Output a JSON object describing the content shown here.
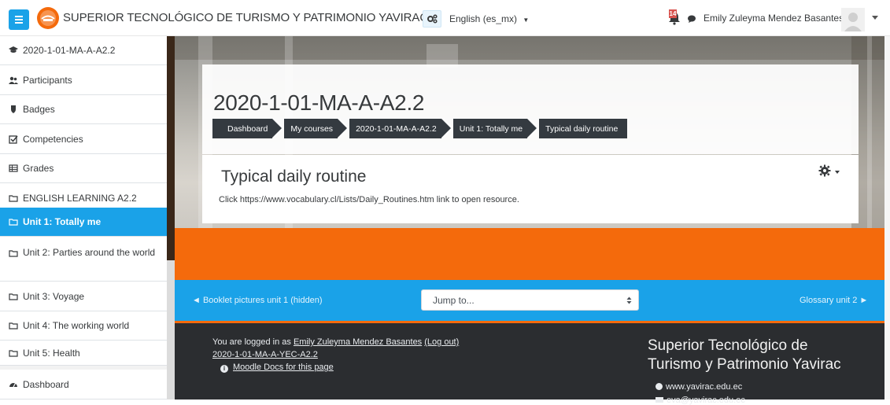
{
  "navbar": {
    "site_name": "SUPERIOR TECNOLÓGICO DE TURISMO Y PATRIMONIO YAVIRAC",
    "language": "English (es_mx)",
    "notification_count": "14",
    "user_name": "Emily Zuleyma Mendez Basantes",
    "accent_color": "#1aa2e8"
  },
  "sidebar": {
    "items": [
      {
        "label": "2020-1-01-MA-A-A2.2",
        "icon": "graduation-cap-icon"
      },
      {
        "label": "Participants",
        "icon": "users-icon"
      },
      {
        "label": "Badges",
        "icon": "shield-icon"
      },
      {
        "label": "Competencies",
        "icon": "check-square-icon"
      },
      {
        "label": "Grades",
        "icon": "table-icon"
      },
      {
        "label": "ENGLISH LEARNING A2.2",
        "icon": "folder-icon"
      },
      {
        "label": "Unit 1: Totally me",
        "icon": "folder-icon",
        "active": true
      },
      {
        "label": "Unit 2: Parties around the world",
        "icon": "folder-icon"
      },
      {
        "label": "Unit 3: Voyage",
        "icon": "folder-icon"
      },
      {
        "label": "Unit 4: The working world",
        "icon": "folder-icon"
      },
      {
        "label": "Unit 5: Health",
        "icon": "folder-icon"
      },
      {
        "label": "Dashboard",
        "icon": "tachometer-icon"
      }
    ]
  },
  "header": {
    "course_title": "2020-1-01-MA-A-A2.2",
    "breadcrumb": [
      "Dashboard",
      "My courses",
      "2020-1-01-MA-A-A2.2",
      "Unit 1: Totally me",
      "Typical daily routine"
    ]
  },
  "content": {
    "heading": "Typical daily routine",
    "resource_text": "Click https://www.vocabulary.cl/Lists/Daily_Routines.htm link to open resource."
  },
  "activity_nav": {
    "prev": "◄ Booklet pictures unit 1 (hidden)",
    "jump_placeholder": "Jump to...",
    "next": "Glossary unit 2 ►"
  },
  "footer": {
    "logged_in_prefix": "You are logged in as ",
    "user_link": "Emily Zuleyma Mendez Basantes",
    "logout": "(Log out)",
    "course_link": "2020-1-01-MA-A-YEC-A2.2",
    "docs_link": "Moodle Docs for this page",
    "org_line1": "Superior Tecnológico de",
    "org_line2": "Turismo y Patrimonio Yavirac",
    "website": "www.yavirac.edu.ec",
    "email": "eva@yavirac.edu.ec"
  }
}
